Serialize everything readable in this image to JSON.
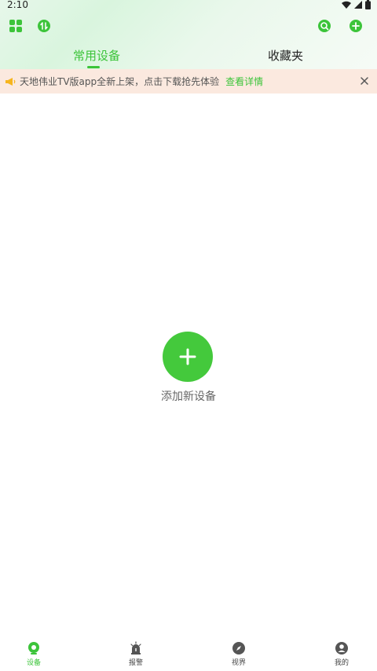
{
  "status_bar": {
    "time": "2:10"
  },
  "header": {
    "tabs": [
      {
        "label": "常用设备",
        "active": true
      },
      {
        "label": "收藏夹",
        "active": false
      }
    ]
  },
  "notice": {
    "text": "天地伟业TV版app全新上架，点击下载抢先体验",
    "link": "查看详情"
  },
  "main": {
    "add_device_label": "添加新设备"
  },
  "bottom_nav": [
    {
      "label": "设备",
      "icon": "camera-icon",
      "active": true
    },
    {
      "label": "报警",
      "icon": "alarm-icon",
      "active": false
    },
    {
      "label": "视界",
      "icon": "compass-icon",
      "active": false
    },
    {
      "label": "我的",
      "icon": "user-icon",
      "active": false
    }
  ],
  "colors": {
    "accent": "#3cc43a",
    "notice_bg": "#fbe9df"
  }
}
